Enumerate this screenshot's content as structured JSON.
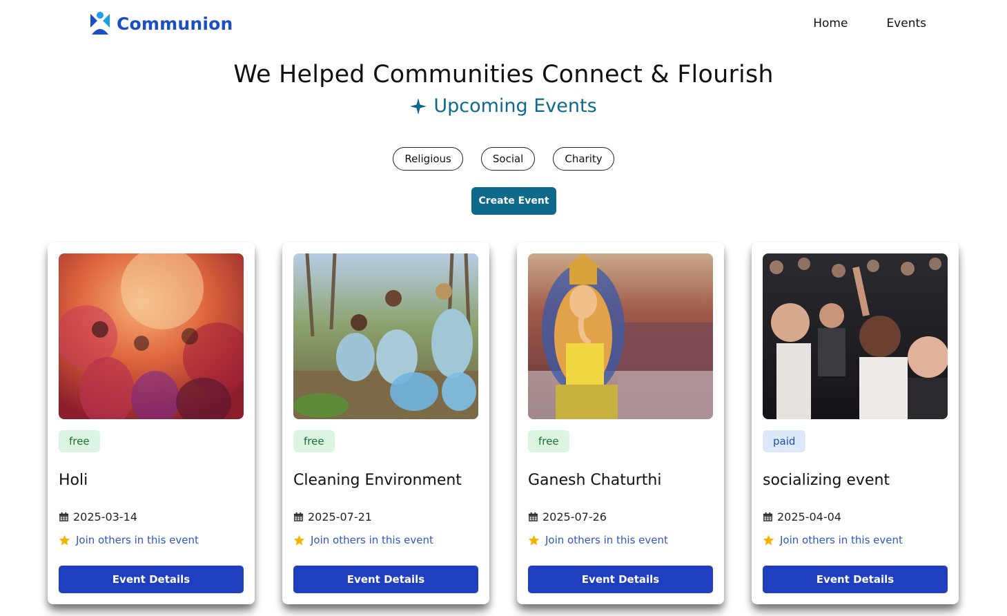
{
  "brand": {
    "name": "Communion",
    "logo_icon": "communion-logo-icon",
    "color": "#1d4fc4"
  },
  "nav": {
    "items": [
      {
        "label": "Home"
      },
      {
        "label": "Events"
      }
    ]
  },
  "hero": {
    "title": "We Helped Communities Connect & Flourish",
    "subtitle": "Upcoming Events",
    "subtitle_icon": "sparkle-icon",
    "accent_color": "#0e6a8a"
  },
  "filters": [
    {
      "label": "Religious"
    },
    {
      "label": "Social"
    },
    {
      "label": "Charity"
    }
  ],
  "create_button": {
    "label": "Create Event"
  },
  "events": [
    {
      "price": "free",
      "title": "Holi",
      "date": "2025-03-14",
      "join_text": "Join others in this event",
      "button_label": "Event Details",
      "image": "holi-festival-photo"
    },
    {
      "price": "free",
      "title": "Cleaning Environment",
      "date": "2025-07-21",
      "join_text": "Join others in this event",
      "button_label": "Event Details",
      "image": "volunteers-cleanup-photo"
    },
    {
      "price": "free",
      "title": "Ganesh Chaturthi",
      "date": "2025-07-26",
      "join_text": "Join others in this event",
      "button_label": "Event Details",
      "image": "ganesh-idol-procession-photo"
    },
    {
      "price": "paid",
      "title": "socializing event",
      "date": "2025-04-04",
      "join_text": "Join others in this event",
      "button_label": "Event Details",
      "image": "concert-crowd-photo"
    }
  ],
  "colors": {
    "free_badge_bg": "#dcf5e3",
    "paid_badge_bg": "#dde8fb",
    "details_button": "#1f3fbf",
    "star": "#f5b301"
  }
}
